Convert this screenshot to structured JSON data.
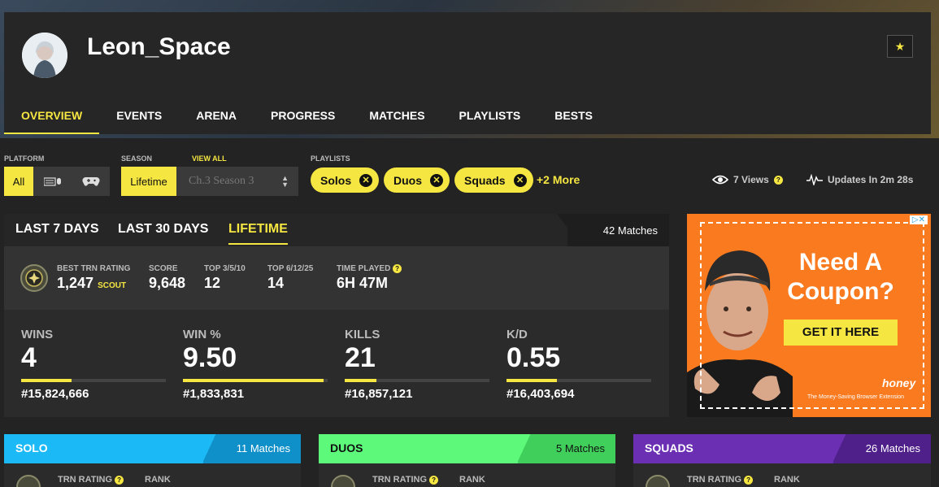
{
  "profile": {
    "username": "Leon_Space",
    "favorite_icon": "star-icon"
  },
  "nav": [
    "OVERVIEW",
    "EVENTS",
    "ARENA",
    "PROGRESS",
    "MATCHES",
    "PLAYLISTS",
    "BESTS"
  ],
  "filters": {
    "platform_label": "PLATFORM",
    "platform_all": "All",
    "platform_icons": [
      "keyboard-mouse-icon",
      "gamepad-icon"
    ],
    "season_label": "SEASON",
    "view_all": "VIEW ALL",
    "season_lifetime": "Lifetime",
    "season_select": "Ch.3 Season 3",
    "playlists_label": "PLAYLISTS",
    "playlists": [
      "Solos",
      "Duos",
      "Squads"
    ],
    "more": "+2 More",
    "views": "7 Views",
    "updates": "Updates In 2m 28s"
  },
  "stats": {
    "tabs": [
      "LAST 7 DAYS",
      "LAST 30 DAYS",
      "LIFETIME"
    ],
    "matches": "42 Matches",
    "summary": {
      "trn_label": "BEST TRN RATING",
      "trn_value": "1,247",
      "trn_tier": "SCOUT",
      "score_label": "SCORE",
      "score_value": "9,648",
      "top3_label": "TOP 3/5/10",
      "top3_value": "12",
      "top6_label": "TOP 6/12/25",
      "top6_value": "14",
      "time_label": "TIME PLAYED",
      "time_value": "6H 47M"
    },
    "big": [
      {
        "label": "WINS",
        "value": "4",
        "rank": "#15,824,666",
        "fill": 0.35
      },
      {
        "label": "WIN %",
        "value": "9.50",
        "rank": "#1,833,831",
        "fill": 0.97
      },
      {
        "label": "KILLS",
        "value": "21",
        "rank": "#16,857,121",
        "fill": 0.22
      },
      {
        "label": "K/D",
        "value": "0.55",
        "rank": "#16,403,694",
        "fill": 0.35
      }
    ]
  },
  "ad": {
    "headline": "Need A Coupon?",
    "cta": "GET IT HERE",
    "brand": "honey",
    "tagline": "The Money-Saving Browser Extension",
    "choices": "▷✕"
  },
  "modes": [
    {
      "title": "SOLO",
      "matches": "11 Matches",
      "color": "#1bb9f5",
      "corner": "#1090c8"
    },
    {
      "title": "DUOS",
      "matches": "5 Matches",
      "color": "#5cf97a",
      "corner": "#3fcf5a"
    },
    {
      "title": "SQUADS",
      "matches": "26 Matches",
      "color": "#6b2fb3",
      "corner": "#4f1f8a"
    }
  ],
  "mode_labels": {
    "trn": "TRN RATING",
    "rank": "RANK"
  }
}
